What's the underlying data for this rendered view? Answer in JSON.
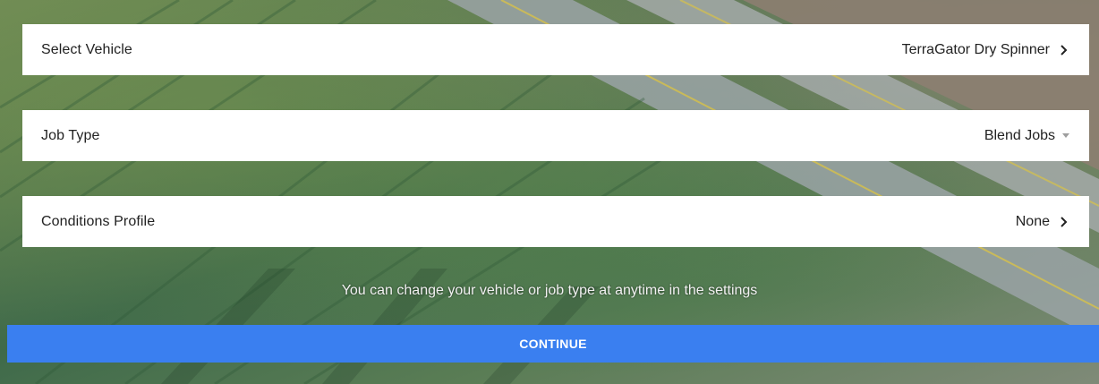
{
  "rows": [
    {
      "label": "Select Vehicle",
      "value": "TerraGator Dry Spinner",
      "control": "chevron-right-icon"
    },
    {
      "label": "Job Type",
      "value": "Blend Jobs",
      "control": "dropdown-caret-icon"
    },
    {
      "label": "Conditions Profile",
      "value": "None",
      "control": "chevron-right-icon"
    }
  ],
  "hint": "You can change your vehicle or job type at anytime in the settings",
  "continue_label": "CONTINUE",
  "colors": {
    "primary_button": "#3a7ff0",
    "row_background": "#ffffff",
    "caret": "#9e9e9e"
  }
}
